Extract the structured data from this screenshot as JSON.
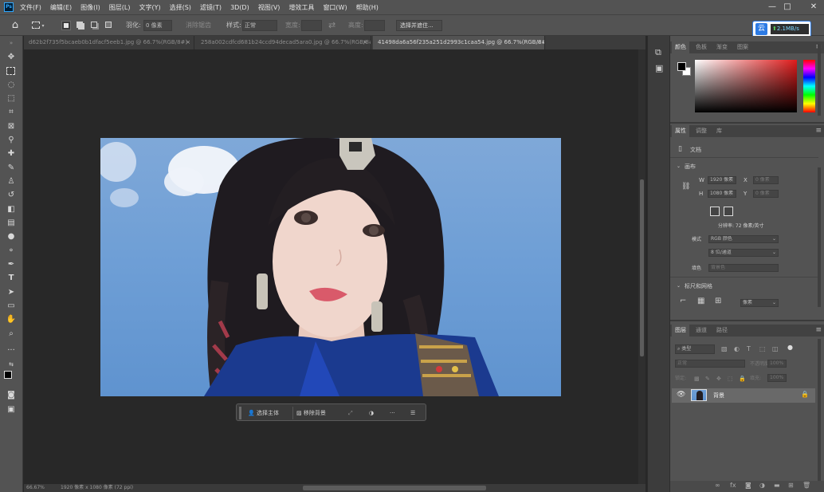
{
  "menubar": {
    "items": [
      "文件(F)",
      "编辑(E)",
      "图像(I)",
      "图层(L)",
      "文字(Y)",
      "选择(S)",
      "滤镜(T)",
      "3D(D)",
      "视图(V)",
      "增效工具",
      "窗口(W)",
      "帮助(H)"
    ],
    "minimize": "—",
    "maximize": "□",
    "close": "✕"
  },
  "options": {
    "feather_label": "羽化:",
    "feather_value": "0 像素",
    "antialias_label": "消除锯齿",
    "style_label": "样式:",
    "style_value": "正常",
    "width_label": "宽度:",
    "height_label": "高度:",
    "select_subject_button": "选择并遮住..."
  },
  "download_badge": {
    "label": "2.1MB/s",
    "icon_char": "云"
  },
  "tabs": [
    {
      "label": "d62b2f735f5bcaeb0b1dfacf5eeb1.jpg @ 66.7%(RGB/8#)",
      "close": "×"
    },
    {
      "label": "258a002cdfcd681b24ccd94decad5ara0.jpg @ 66.7%(RGB/8#)",
      "close": "×"
    },
    {
      "label": "41498da6a56f235a251d2993c1caa54.jpg @ 66.7%(RGB/8#)",
      "close": "×",
      "active": true
    }
  ],
  "context_bar": {
    "select_subject": "选择主体",
    "remove_background": "移除背景",
    "more": "···"
  },
  "status": {
    "zoom": "66.67%",
    "doc_info": "1920 像素 x 1080 像素 (72 ppi)"
  },
  "color_panel": {
    "tabs": [
      "颜色",
      "色板",
      "渐变",
      "图案"
    ]
  },
  "properties_panel": {
    "tabs": [
      "属性",
      "调整",
      "库"
    ],
    "doc_label": "文档",
    "canvas_section": "画布",
    "w_label": "W",
    "w_value": "1920 像素",
    "x_label": "X",
    "x_value": "0 像素",
    "h_label": "H",
    "h_value": "1080 像素",
    "y_label": "Y",
    "y_value": "0 像素",
    "resolution": "分辨率: 72 像素/英寸",
    "mode_label": "模式",
    "mode_value": "RGB 颜色",
    "depth_value": "8 位/通道",
    "fill_label": "填色",
    "fill_value": "背景色",
    "rulers_section": "标尺和网格",
    "units_value": "像素"
  },
  "layers_panel": {
    "tabs": [
      "图层",
      "通道",
      "路径"
    ],
    "search_placeholder": "类型",
    "blend_mode": "正常",
    "opacity_label": "不透明度:",
    "opacity_value": "100%",
    "lock_label": "锁定:",
    "fill_label": "填充:",
    "fill_value": "100%",
    "layer_name": "背景"
  }
}
